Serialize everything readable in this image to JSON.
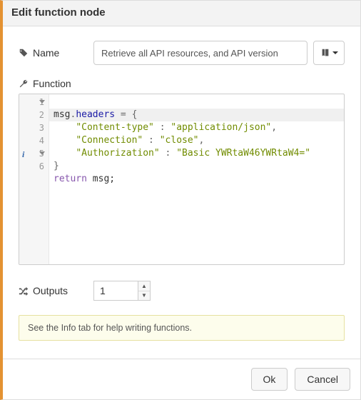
{
  "header": {
    "title": "Edit function node"
  },
  "form": {
    "name_label": "Name",
    "name_value": "Retrieve all API resources, and API version",
    "function_label": "Function",
    "outputs_label": "Outputs",
    "outputs_value": "1"
  },
  "editor": {
    "gutter": [
      {
        "num": "1",
        "fold": true
      },
      {
        "num": "2"
      },
      {
        "num": "3"
      },
      {
        "num": "4"
      },
      {
        "num": "5",
        "foldup": true,
        "info": true
      },
      {
        "num": "6"
      }
    ],
    "code_tokens": {
      "l1": {
        "a": "msg",
        "b": ".",
        "c": "headers",
        "d": " = {"
      },
      "l2": {
        "a": "\"Content-type\"",
        "b": " : ",
        "c": "\"application/json\"",
        "d": ","
      },
      "l3": {
        "a": "\"Connection\"",
        "b": " : ",
        "c": "\"close\"",
        "d": ","
      },
      "l4": {
        "a": "\"Authorization\"",
        "b": " : ",
        "c": "\"Basic YWRtaW46YWRtaW4=\""
      },
      "l5": {
        "a": "}"
      },
      "l6": {
        "a": "return",
        "b": " msg;"
      }
    }
  },
  "tip": {
    "text": "See the Info tab for help writing functions."
  },
  "footer": {
    "ok": "Ok",
    "cancel": "Cancel"
  }
}
